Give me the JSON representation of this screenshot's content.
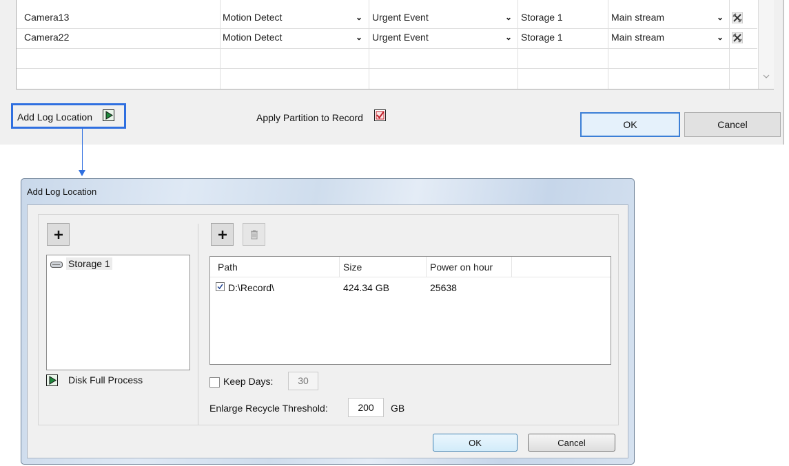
{
  "record_table": {
    "rows": [
      {
        "camera": "Camera13",
        "trigger": "Motion Detect",
        "event": "Urgent Event",
        "storage": "Storage 1",
        "stream": "Main stream"
      },
      {
        "camera": "Camera22",
        "trigger": "Motion Detect",
        "event": "Urgent Event",
        "storage": "Storage 1",
        "stream": "Main stream"
      }
    ],
    "dropdown_icon": "chevron-down-icon",
    "settings_icon": "tools-icon"
  },
  "footer": {
    "add_log_label": "Add Log Location",
    "apply_label": "Apply Partition to Record",
    "apply_checked": true,
    "ok_label": "OK",
    "cancel_label": "Cancel"
  },
  "dialog": {
    "title": "Add Log Location",
    "storage_items": [
      "Storage 1"
    ],
    "disk_full_label": "Disk Full Process",
    "path_columns": [
      "Path",
      "Size",
      "Power on hour"
    ],
    "paths": [
      {
        "checked": true,
        "path": "D:\\Record\\",
        "size": "424.34 GB",
        "power_on_hour": "25638"
      }
    ],
    "keep_days_label": "Keep Days:",
    "keep_days_checked": false,
    "keep_days_value": "30",
    "recycle_label": "Enlarge Recycle Threshold:",
    "recycle_value": "200",
    "recycle_unit": "GB",
    "ok_label": "OK",
    "cancel_label": "Cancel"
  },
  "colors": {
    "highlight": "#2f6fe0",
    "play_icon": "#1e8a3c",
    "check_red": "#c0202a"
  }
}
